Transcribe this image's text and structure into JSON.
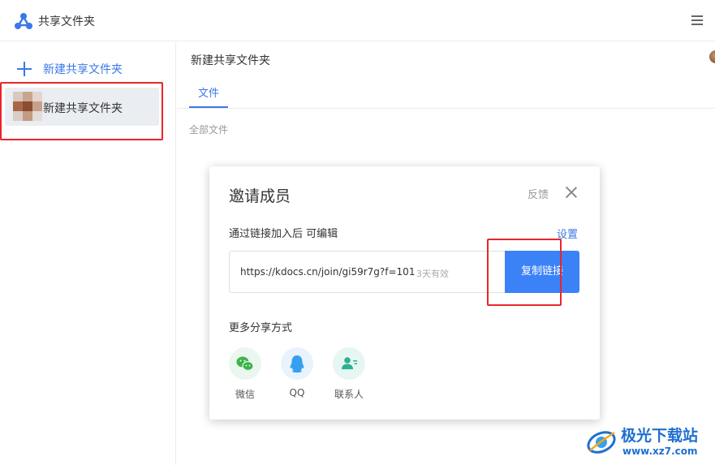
{
  "app": {
    "title": "共享文件夹"
  },
  "sidebar": {
    "new_folder_label": "新建共享文件夹",
    "folders": [
      {
        "label": "新建共享文件夹"
      }
    ]
  },
  "main": {
    "title": "新建共享文件夹",
    "tabs": [
      {
        "label": "文件",
        "active": true
      }
    ],
    "breadcrumb": "全部文件"
  },
  "modal": {
    "title": "邀请成员",
    "feedback": "反馈",
    "permission_text": "通过链接加入后 可编辑",
    "settings": "设置",
    "link_url": "https://kdocs.cn/join/gi59r7g?f=101",
    "link_expiry": "3天有效",
    "copy_button": "复制链接",
    "more_title": "更多分享方式",
    "share_options": [
      {
        "label": "微信",
        "icon": "wechat-icon",
        "bg": "#e9f7ee",
        "color": "#3cb34a"
      },
      {
        "label": "QQ",
        "icon": "qq-icon",
        "bg": "#e8f3fd",
        "color": "#36a0ef"
      },
      {
        "label": "联系人",
        "icon": "contacts-icon",
        "bg": "#e6f6f2",
        "color": "#2bb18d"
      }
    ]
  },
  "watermark": {
    "name": "极光下载站",
    "url": "www.xz7.com"
  },
  "colors": {
    "accent": "#3b78e7",
    "button": "#3b82f6",
    "highlight": "#e8262a"
  }
}
